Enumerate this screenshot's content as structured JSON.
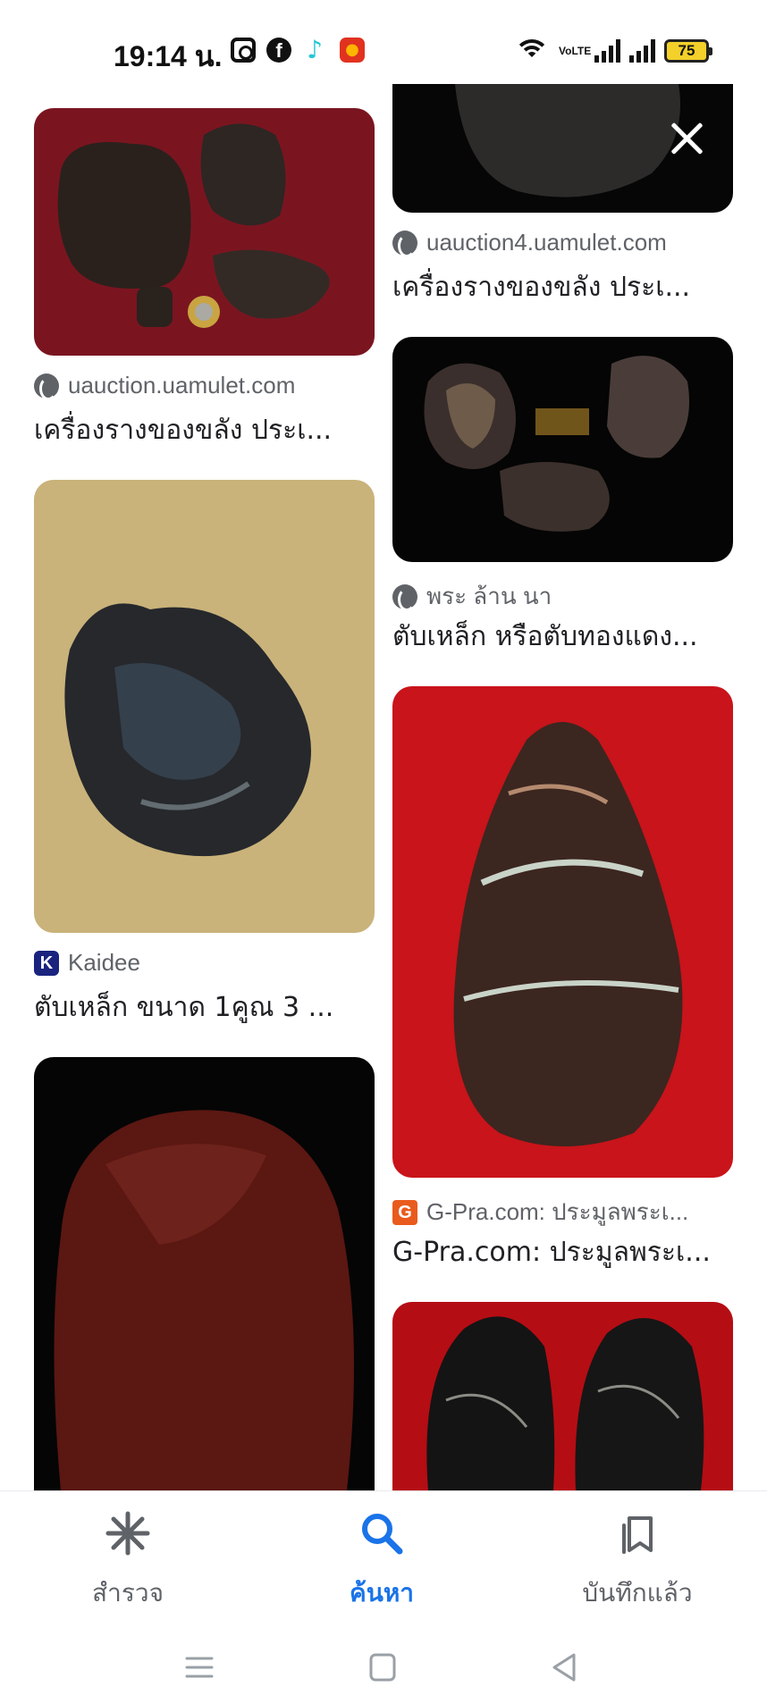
{
  "status_bar": {
    "time": "19:14 น.",
    "volte": "VoLTE",
    "battery": "75"
  },
  "results": [
    {
      "source": "uauction.uamulet.com",
      "title": "เครื่องรางของขลัง ประเ...",
      "favicon": "globe-icon"
    },
    {
      "source": "Kaidee",
      "title": "ตับเหล็ก ขนาด 1คูณ 3 ...",
      "favicon": "kaidee-icon"
    },
    {
      "source": "uauction4.uamulet.com",
      "title": "เครื่องรางของขลัง ประเ...",
      "favicon": "globe-icon"
    },
    {
      "source": "พระ ล้าน นา",
      "title": "ตับเหล็ก หรือตับทองแดง...",
      "favicon": "globe-icon"
    },
    {
      "source": "G-Pra.com: ประมูลพระเ...",
      "title": "G-Pra.com: ประมูลพระเ...",
      "favicon": "gpra-icon"
    }
  ],
  "bottom_nav": {
    "explore": "สำรวจ",
    "search": "ค้นหา",
    "saved": "บันทึกแล้ว"
  },
  "colors": {
    "accent": "#1a73e8",
    "secondary_text": "#5f6368"
  }
}
